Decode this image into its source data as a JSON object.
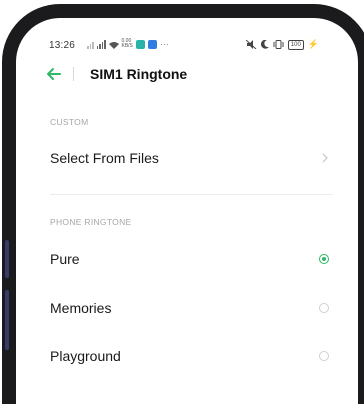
{
  "status_bar": {
    "time": "13:26",
    "net_speed_top": "0.00",
    "net_speed_bottom": "KB/S",
    "more": "···",
    "battery": "100"
  },
  "header": {
    "title": "SIM1 Ringtone"
  },
  "custom": {
    "section_label": "CUSTOM",
    "select_from_files": "Select From Files"
  },
  "phone_ringtone": {
    "section_label": "PHONE RINGTONE",
    "items": [
      {
        "label": "Pure",
        "selected": true
      },
      {
        "label": "Memories",
        "selected": false
      },
      {
        "label": "Playground",
        "selected": false
      }
    ]
  },
  "colors": {
    "accent": "#2fb865",
    "frame": "#1b1b1d"
  }
}
